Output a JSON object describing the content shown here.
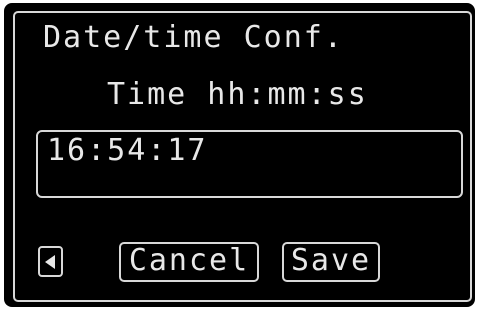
{
  "screen": {
    "title": "Date/time Conf.",
    "subtitle": "Time hh:mm:ss"
  },
  "time_field": {
    "value": "16:54:17"
  },
  "buttons": {
    "back_icon": "left-triangle-icon",
    "cancel_label": "Cancel",
    "save_label": "Save"
  },
  "colors": {
    "background": "#000000",
    "foreground": "#e8e8e8",
    "border": "#d8d8d8"
  }
}
